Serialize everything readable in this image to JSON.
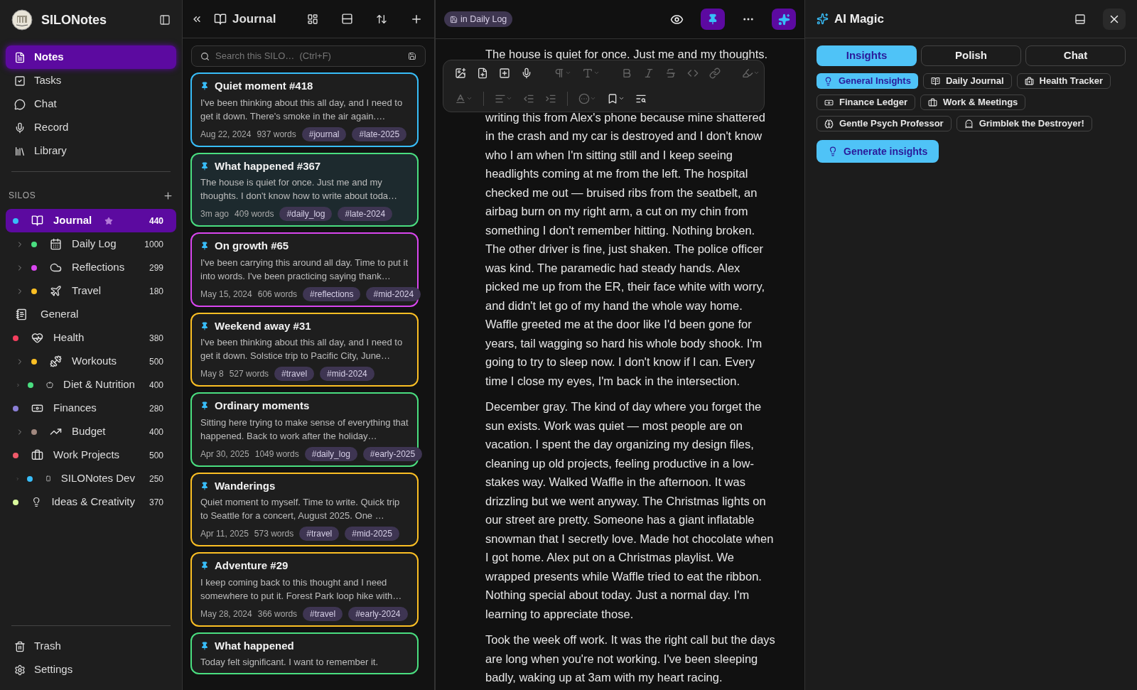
{
  "app": {
    "name": "SILONotes"
  },
  "nav": [
    {
      "label": "Notes",
      "selected": true
    },
    {
      "label": "Tasks",
      "selected": false
    },
    {
      "label": "Chat",
      "selected": false
    },
    {
      "label": "Record",
      "selected": false
    },
    {
      "label": "Library",
      "selected": false
    }
  ],
  "silos_heading": "SILOS",
  "silos": [
    {
      "label": "Journal",
      "color": "#38bdf8",
      "count": "440",
      "starred": true,
      "selected": true,
      "children": [
        {
          "label": "Daily Log",
          "color": "#4ade80",
          "count": "1000",
          "selected": false
        },
        {
          "label": "Reflections",
          "color": "#d946ef",
          "count": "299",
          "selected": false
        },
        {
          "label": "Travel",
          "color": "#fbbf24",
          "count": "180",
          "selected": false
        }
      ]
    },
    {
      "label": "General",
      "selected": false
    },
    {
      "label": "Health",
      "color": "#f43f5e",
      "count": "380",
      "starred": false,
      "selected": false,
      "children": [
        {
          "label": "Workouts",
          "color": "#fbbf24",
          "count": "500",
          "selected": false
        },
        {
          "label": "Diet & Nutrition",
          "color": "#4ade80",
          "count": "400",
          "selected": false
        }
      ]
    },
    {
      "label": "Finances",
      "color": "#8b7fd6",
      "count": "280",
      "starred": false,
      "selected": false,
      "children": [
        {
          "label": "Budget",
          "color": "#a1887f",
          "count": "400",
          "selected": false
        }
      ]
    },
    {
      "label": "Work Projects",
      "color": "#f05a6a",
      "count": "500",
      "starred": false,
      "selected": false,
      "children": [
        {
          "label": "SILONotes Dev",
          "color": "#38bdf8",
          "count": "250",
          "selected": false
        }
      ]
    },
    {
      "label": "Ideas & Creativity",
      "color": "#d9f99d",
      "count": "370",
      "starred": false,
      "selected": false
    }
  ],
  "footer_nav": [
    "Trash",
    "Settings"
  ],
  "list": {
    "title": "Journal",
    "search": {
      "placeholder": "Search this SILO…  (Ctrl+F)"
    },
    "notes": [
      {
        "title": "Quiet moment #418",
        "preview": "I've been thinking about this all day, and I need to get it down. There's smoke in the air again.…",
        "date": "Aug 22, 2024",
        "words": "937 words",
        "tags": [
          "#journal",
          "#late-2025"
        ],
        "color": "#38bdf8",
        "selected": false
      },
      {
        "title": "What happened #367",
        "preview": "The house is quiet for once. Just me and my thoughts. I don't know how to write about toda…",
        "date": "3m ago",
        "words": "409 words",
        "tags": [
          "#daily_log",
          "#late-2024"
        ],
        "color": "#4ade80",
        "selected": true
      },
      {
        "title": "On growth #65",
        "preview": "I've been carrying this around all day. Time to put it into words. I've been practicing saying thank…",
        "date": "May 15, 2024",
        "words": "606 words",
        "tags": [
          "#reflections",
          "#mid-2024"
        ],
        "color": "#d946ef",
        "selected": false
      },
      {
        "title": "Weekend away #31",
        "preview": "I've been thinking about this all day, and I need to get it down. Solstice trip to Pacific City, June…",
        "date": "May 8",
        "words": "527 words",
        "tags": [
          "#travel",
          "#mid-2024"
        ],
        "color": "#fbbf24",
        "selected": false
      },
      {
        "title": "Ordinary moments",
        "preview": "Sitting here trying to make sense of everything that happened. Back to work after the holiday…",
        "date": "Apr 30, 2025",
        "words": "1049 words",
        "tags": [
          "#daily_log",
          "#early-2025"
        ],
        "color": "#4ade80",
        "selected": false
      },
      {
        "title": "Wanderings",
        "preview": "Quiet moment to myself. Time to write. Quick trip to Seattle for a concert, August 2025. One …",
        "date": "Apr 11, 2025",
        "words": "573 words",
        "tags": [
          "#travel",
          "#mid-2025"
        ],
        "color": "#fbbf24",
        "selected": false
      },
      {
        "title": "Adventure #29",
        "preview": "I keep coming back to this thought and I need somewhere to put it. Forest Park loop hike with…",
        "date": "May 28, 2024",
        "words": "366 words",
        "tags": [
          "#travel",
          "#early-2024"
        ],
        "color": "#fbbf24",
        "selected": false
      },
      {
        "title": "What happened",
        "preview": "Today felt significant. I want to remember it.",
        "color": "#4ade80",
        "selected": false
      }
    ]
  },
  "editor": {
    "location": "in Daily Log",
    "pinned": true,
    "ai_open": true,
    "first_line": "The house is quiet for once. Just me and my thoughts.",
    "paragraphs": [
      "writing this from Alex's phone because mine shattered in the crash and my car is destroyed and I don't know who I am when I'm sitting still and I keep seeing headlights coming at me from the left. The hospital checked me out — bruised ribs from the seatbelt, an airbag burn on my right arm, a cut on my chin from something I don't remember hitting. Nothing broken. The other driver is fine, just shaken. The police officer was kind. The paramedic had steady hands. Alex picked me up from the ER, their face white with worry, and didn't let go of my hand the whole way home. Waffle greeted me at the door like I'd been gone for years, tail wagging so hard his whole body shook. I'm going to try to sleep now. I don't know if I can. Every time I close my eyes, I'm back in the intersection.",
      "December gray. The kind of day where you forget the sun exists. Work was quiet — most people are on vacation. I spent the day organizing my design files, cleaning up old projects, feeling productive in a low-stakes way. Walked Waffle in the afternoon. It was drizzling but we went anyway. The Christmas lights on our street are pretty. Someone has a giant inflatable snowman that I secretly love. Made hot chocolate when I got home. Alex put on a Christmas playlist. We wrapped presents while Waffle tried to eat the ribbon. Nothing special about today. Just a normal day. I'm learning to appreciate those.",
      "Took the week off work. It was the right call but the days are long when you're not working. I've been sleeping badly, waking up at 3am with my heart racing."
    ]
  },
  "ai": {
    "title": "AI Magic",
    "tabs": [
      {
        "label": "Insights",
        "selected": true
      },
      {
        "label": "Polish",
        "selected": false
      },
      {
        "label": "Chat",
        "selected": false
      }
    ],
    "personas": [
      {
        "label": "General Insights",
        "selected": true
      },
      {
        "label": "Daily Journal",
        "selected": false
      },
      {
        "label": "Health Tracker",
        "selected": false
      },
      {
        "label": "Finance Ledger",
        "selected": false
      },
      {
        "label": "Work & Meetings",
        "selected": false
      },
      {
        "label": "Gentle Psych Professor",
        "selected": false
      },
      {
        "label": "Grimblek the Destroyer!",
        "selected": false
      }
    ],
    "action": "Generate insights"
  }
}
